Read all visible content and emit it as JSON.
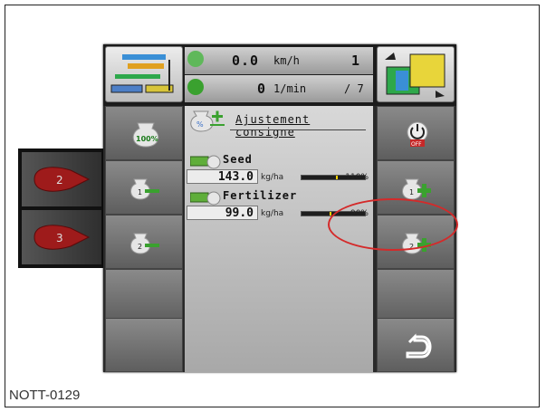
{
  "reference": "NOTT-0129",
  "header": {
    "speed_value": "0.0",
    "speed_unit": "km/h",
    "rpm_value": "0",
    "rpm_unit": "1/min",
    "section_count": "1",
    "section_index": "/ 7"
  },
  "title": "Ajustement consigne",
  "products": [
    {
      "name": "Seed",
      "value": "143.0",
      "unit": "kg/ha",
      "percent": "110%",
      "level": 1.1
    },
    {
      "name": "Fertilizer",
      "value": "99.0",
      "unit": "kg/ha",
      "percent": "90%",
      "level": 0.9
    }
  ],
  "left_buttons": {
    "reset_label": "100%",
    "product1_badge": "1",
    "product2_badge": "2"
  },
  "right_buttons": {
    "off_label": "OFF",
    "product1_badge": "1",
    "product2_badge": "2"
  },
  "external_buttons": {
    "b1_label": "2",
    "b2_label": "3"
  },
  "colors": {
    "highlight": "#d42a2a",
    "bar_marker": "#ffd400",
    "minus": "#3aa12f",
    "plus": "#3aa12f"
  }
}
